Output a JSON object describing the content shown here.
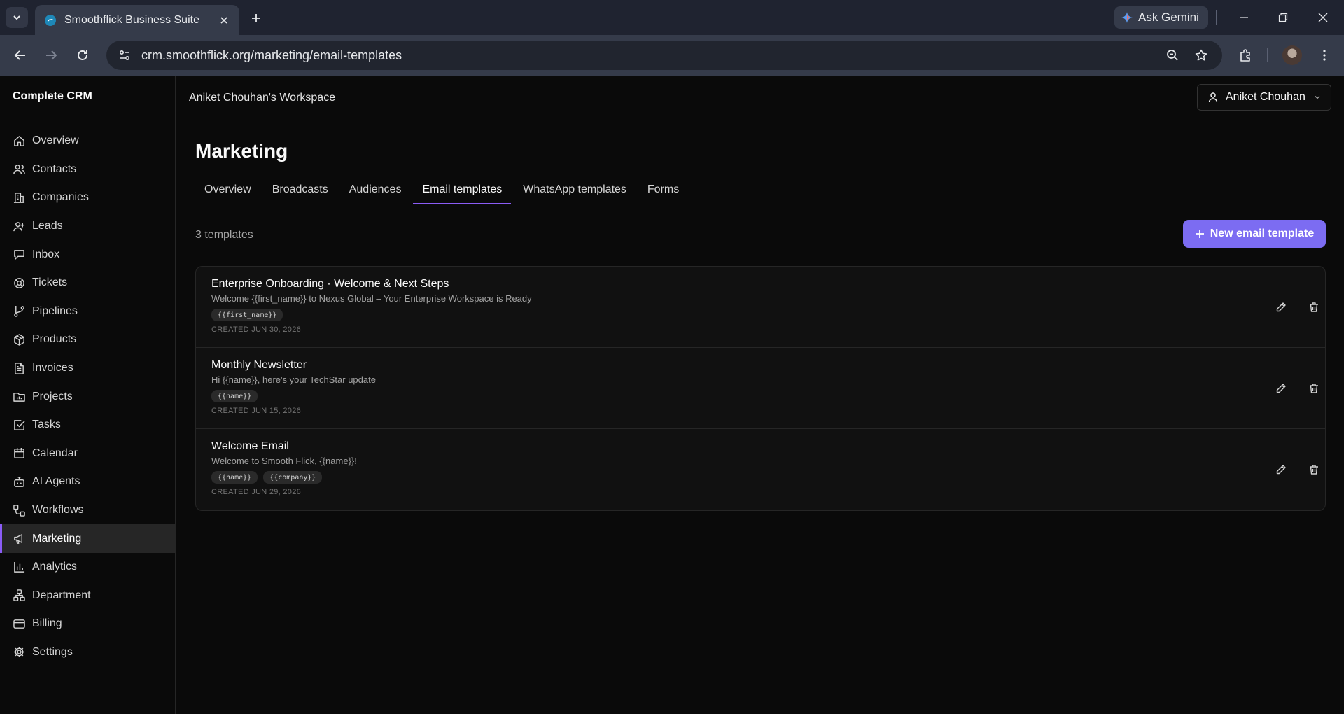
{
  "browser": {
    "tab_title": "Smoothflick Business Suite",
    "url": "crm.smoothflick.org/marketing/email-templates",
    "gemini_label": "Ask Gemini"
  },
  "app": {
    "brand": "Complete CRM",
    "workspace": "Aniket Chouhan's Workspace",
    "user_name": "Aniket Chouhan"
  },
  "sidebar": {
    "items": [
      {
        "label": "Overview",
        "icon": "home-icon"
      },
      {
        "label": "Contacts",
        "icon": "users-icon"
      },
      {
        "label": "Companies",
        "icon": "building-icon"
      },
      {
        "label": "Leads",
        "icon": "user-plus-icon"
      },
      {
        "label": "Inbox",
        "icon": "message-icon"
      },
      {
        "label": "Tickets",
        "icon": "lifebuoy-icon"
      },
      {
        "label": "Pipelines",
        "icon": "git-branch-icon"
      },
      {
        "label": "Products",
        "icon": "package-icon"
      },
      {
        "label": "Invoices",
        "icon": "file-text-icon"
      },
      {
        "label": "Projects",
        "icon": "chart-folder-icon"
      },
      {
        "label": "Tasks",
        "icon": "check-square-icon"
      },
      {
        "label": "Calendar",
        "icon": "calendar-icon"
      },
      {
        "label": "AI Agents",
        "icon": "bot-icon"
      },
      {
        "label": "Workflows",
        "icon": "workflow-icon"
      },
      {
        "label": "Marketing",
        "icon": "megaphone-icon",
        "active": true
      },
      {
        "label": "Analytics",
        "icon": "bar-chart-icon"
      },
      {
        "label": "Department",
        "icon": "network-icon"
      },
      {
        "label": "Billing",
        "icon": "credit-card-icon"
      },
      {
        "label": "Settings",
        "icon": "gear-icon"
      }
    ]
  },
  "page": {
    "title": "Marketing",
    "tabs": [
      {
        "label": "Overview"
      },
      {
        "label": "Broadcasts"
      },
      {
        "label": "Audiences"
      },
      {
        "label": "Email templates",
        "active": true
      },
      {
        "label": "WhatsApp templates"
      },
      {
        "label": "Forms"
      }
    ],
    "count_label": "3 templates",
    "new_button_label": "New email template"
  },
  "templates": [
    {
      "name": "Enterprise Onboarding - Welcome & Next Steps",
      "subject": "Welcome {{first_name}} to Nexus Global – Your Enterprise Workspace is Ready",
      "variables": [
        "{{first_name}}"
      ],
      "created": "CREATED JUN 30, 2026"
    },
    {
      "name": "Monthly Newsletter",
      "subject": "Hi {{name}}, here's your TechStar update",
      "variables": [
        "{{name}}"
      ],
      "created": "CREATED JUN 15, 2026"
    },
    {
      "name": "Welcome Email",
      "subject": "Welcome to Smooth Flick, {{name}}!",
      "variables": [
        "{{name}}",
        "{{company}}"
      ],
      "created": "CREATED JUN 29, 2026"
    }
  ],
  "colors": {
    "accent": "#8b5cf6",
    "primary_button": "#7c6cf2",
    "background": "#0a0a0a"
  }
}
